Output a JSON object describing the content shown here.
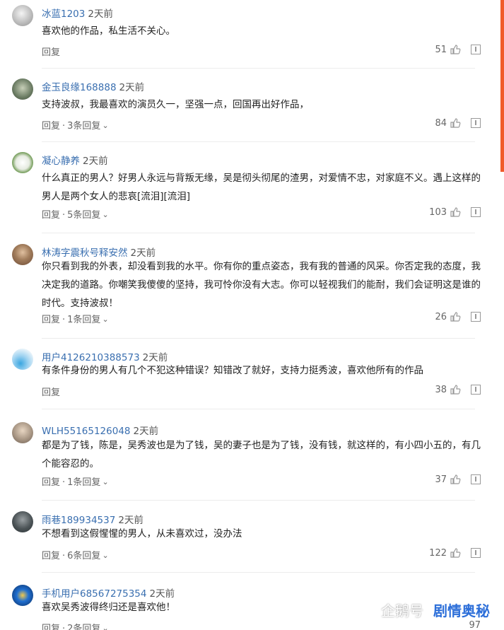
{
  "comments": [
    {
      "user": "冰蓝1203",
      "time": "2天前",
      "text": "喜欢他的作品，私生活不关心。",
      "reply": "回复",
      "replies": "",
      "likes": "51"
    },
    {
      "user": "金玉良缘168888",
      "time": "2天前",
      "text": "支持波叔，我最喜欢的演员久一，坚强一点，回国再出好作品，",
      "reply": "回复",
      "replies": "3条回复",
      "likes": "84"
    },
    {
      "user": "凝心静养",
      "time": "2天前",
      "text": "什么真正的男人？好男人永远与背叛无缘，吴是彻头彻尾的渣男，对爱情不忠，对家庭不义。遇上这样的男人是两个女人的悲哀[流泪][流泪]",
      "reply": "回复",
      "replies": "5条回复",
      "likes": "103"
    },
    {
      "user": "林涛字震秋号释安然",
      "time": "2天前",
      "text": "你只看到我的外表，却没看到我的水平。你有你的重点姿态，我有我的普通的风采。你否定我的态度，我决定我的道路。你嘲笑我傻傻的坚持，我可怜你没有大志。你可以轻视我们的能耐，我们会证明这是谁的时代。支持波叔！",
      "reply": "回复",
      "replies": "1条回复",
      "likes": "26"
    },
    {
      "user": "用户4126210388573",
      "time": "2天前",
      "text": "有条件身份的男人有几个不犯这种错误？知错改了就好，支持力挺秀波，喜欢他所有的作品",
      "reply": "回复",
      "replies": "",
      "likes": "38"
    },
    {
      "user": "WLH55165126048",
      "time": "2天前",
      "text": "都是为了钱，陈是，吴秀波也是为了钱，吴的妻子也是为了钱，没有钱，就这样的，有小四小五的，有几个能容忍的。",
      "reply": "回复",
      "replies": "1条回复",
      "likes": "37"
    },
    {
      "user": "雨巷189934537",
      "time": "2天前",
      "text": "不想看到这假惺惺的男人，从未喜欢过，没办法",
      "reply": "回复",
      "replies": "6条回复",
      "likes": "122"
    },
    {
      "user": "手机用户68567275354",
      "time": "2天前",
      "text": "喜欢吴秀波得终归还是喜欢他！",
      "reply": "回复",
      "replies": "2条回复",
      "likes": "97"
    }
  ],
  "watermark": {
    "brand": "企鹅号",
    "tag": "剧情奥秘"
  },
  "icons": {
    "like": "thumbs-up-icon",
    "report": "report-icon",
    "chevron": "chevron-down-icon"
  },
  "colors": {
    "username": "#3a6fb0",
    "accent": "#f05a2a",
    "text": "#222222"
  }
}
